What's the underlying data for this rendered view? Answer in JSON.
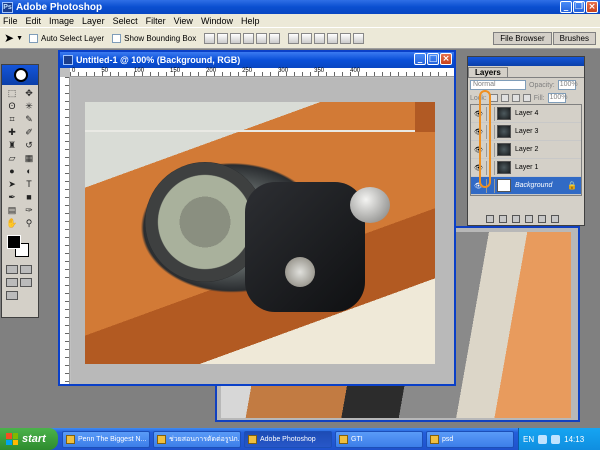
{
  "window": {
    "title": "Adobe Photoshop",
    "icon_label": "Ps"
  },
  "menu": [
    "File",
    "Edit",
    "Image",
    "Layer",
    "Select",
    "Filter",
    "View",
    "Window",
    "Help"
  ],
  "options": {
    "auto_select": "Auto Select Layer",
    "bounding_box": "Show Bounding Box",
    "well_tabs": [
      "File Browser",
      "Brushes"
    ]
  },
  "document": {
    "title": "Untitled-1 @ 100% (Background, RGB)",
    "ruler": [
      "0",
      "50",
      "100",
      "150",
      "200",
      "250",
      "300",
      "350",
      "400"
    ]
  },
  "layers": {
    "tab": "Layers",
    "blend_mode": "Normal",
    "opacity_label": "Opacity:",
    "opacity_value": "100%",
    "lock_label": "Lock:",
    "fill_label": "Fill:",
    "fill_value": "100%",
    "items": [
      {
        "name": "Layer 4"
      },
      {
        "name": "Layer 3"
      },
      {
        "name": "Layer 2"
      },
      {
        "name": "Layer 1"
      },
      {
        "name": "Background"
      }
    ]
  },
  "taskbar": {
    "start": "start",
    "buttons": [
      {
        "label": "Penn The Biggest N..."
      },
      {
        "label": "ช่วยสอนการตัดต่อรูปภ..."
      },
      {
        "label": "Adobe Photoshop"
      },
      {
        "label": "GTI"
      },
      {
        "label": "psd"
      }
    ],
    "lang": "EN",
    "clock": "14:13"
  }
}
